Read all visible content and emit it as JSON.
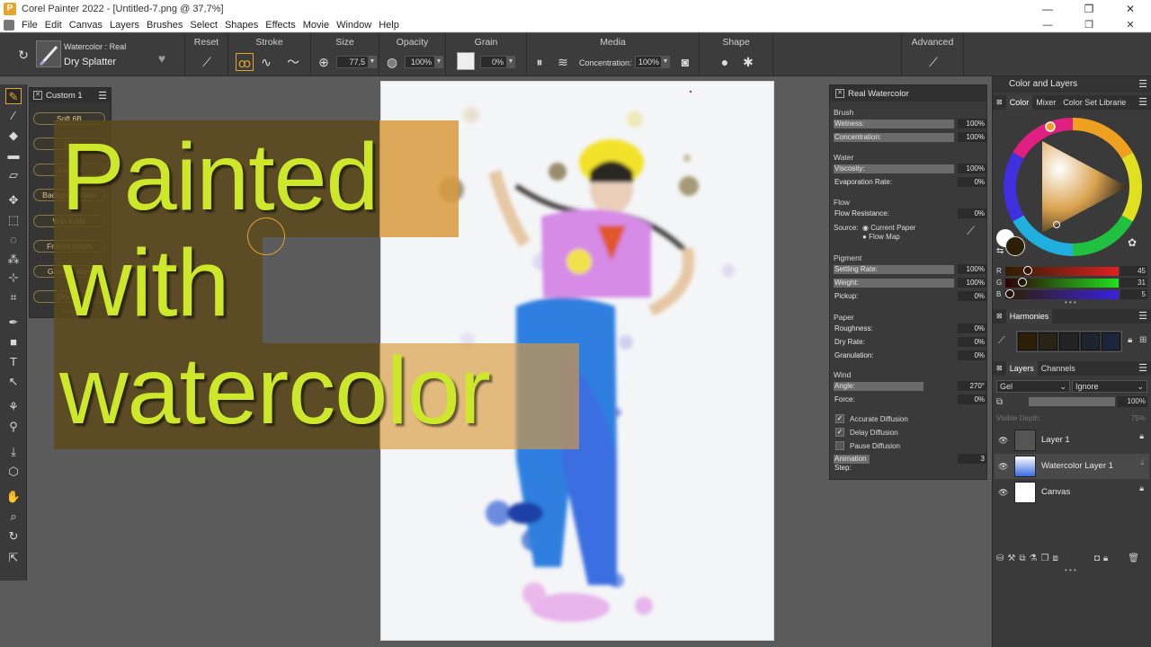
{
  "window": {
    "title": "Corel Painter 2022 - [Untitled-7.png @ 37,7%]",
    "app_icon": "P",
    "minimize": "—",
    "maximize": "❐",
    "close": "✕"
  },
  "menu": {
    "items": [
      "File",
      "Edit",
      "Canvas",
      "Layers",
      "Brushes",
      "Select",
      "Shapes",
      "Effects",
      "Movie",
      "Window",
      "Help"
    ],
    "doc_minimize": "—",
    "doc_restore": "❐",
    "doc_close": "✕"
  },
  "propbar": {
    "brush_category": "Watercolor : Real",
    "brush_variant": "Dry Splatter",
    "reset_label": "Reset",
    "stroke_label": "Stroke",
    "size_label": "Size",
    "size_value": "77,5",
    "opacity_label": "Opacity",
    "opacity_value": "100%",
    "grain_label": "Grain",
    "grain_value": "0%",
    "media_label": "Media",
    "concentration_label": "Concentration:",
    "concentration_value": "100%",
    "shape_label": "Shape",
    "advanced_label": "Advanced"
  },
  "custom_palette": {
    "title": "Custom 1",
    "buttons": [
      "Soft 6B",
      "Lin",
      "Just Ad",
      "Backgrou  Wash",
      "Wet Knife",
      "Fractal Wash",
      "Grain  Eraser",
      "Dry Sp"
    ],
    "more": "• • •"
  },
  "overlay": {
    "line1": "Painted",
    "line2": "with",
    "line3": "watercolor",
    "text_color": "#cde82a",
    "box_dark": "#5b4a1e",
    "box_orange": "#d89a3d"
  },
  "real_watercolor": {
    "title": "Real Watercolor",
    "brush": {
      "heading": "Brush",
      "wetness_label": "Wetness:",
      "wetness_value": "100%",
      "concentration_label": "Concentration:",
      "concentration_value": "100%"
    },
    "water": {
      "heading": "Water",
      "viscosity_label": "Viscosity:",
      "viscosity_value": "100%",
      "evaporation_label": "Evaporation Rate:",
      "evaporation_value": "0%"
    },
    "flow": {
      "heading": "Flow",
      "resistance_label": "Flow Resistance:",
      "resistance_value": "0%",
      "source_label": "Source:",
      "source_opt1": "Current Paper",
      "source_opt2": "Flow Map"
    },
    "pigment": {
      "heading": "Pigment",
      "settling_label": "Settling Rate:",
      "settling_value": "100%",
      "weight_label": "Weight:",
      "weight_value": "100%",
      "pickup_label": "Pickup:",
      "pickup_value": "0%"
    },
    "paper": {
      "heading": "Paper",
      "roughness_label": "Roughness:",
      "roughness_value": "0%",
      "dryrate_label": "Dry Rate:",
      "dryrate_value": "0%",
      "granulation_label": "Granulation:",
      "granulation_value": "0%"
    },
    "wind": {
      "heading": "Wind",
      "angle_label": "Angle:",
      "angle_value": "270°",
      "force_label": "Force:",
      "force_value": "0%"
    },
    "checks": {
      "accurate": "Accurate Diffusion",
      "delay": "Delay Diffusion",
      "pause": "Pause Diffusion"
    },
    "animation_label": "Animation Step:",
    "animation_value": "3"
  },
  "color_panel": {
    "title": "Color and Layers",
    "tabs": [
      "Color",
      "Mixer",
      "Color Set Librarie"
    ],
    "r_label": "R",
    "r_value": "45",
    "g_label": "G",
    "g_value": "31",
    "b_label": "B",
    "b_value": "5",
    "more": "• • •"
  },
  "harmonies": {
    "title": "Harmonies",
    "swatches": [
      "#2d1f05",
      "#2a2418",
      "#232323",
      "#1d2530",
      "#1b2638"
    ]
  },
  "layers": {
    "tabs": [
      "Layers",
      "Channels"
    ],
    "composite_method": "Gel",
    "composite_depth": "Ignore",
    "opacity_value": "100%",
    "visible_depth_label": "Visible Depth:",
    "visible_depth_value": "75%",
    "items": [
      "Layer 1",
      "Watercolor Layer 1",
      "Canvas"
    ],
    "more": "• • •"
  }
}
